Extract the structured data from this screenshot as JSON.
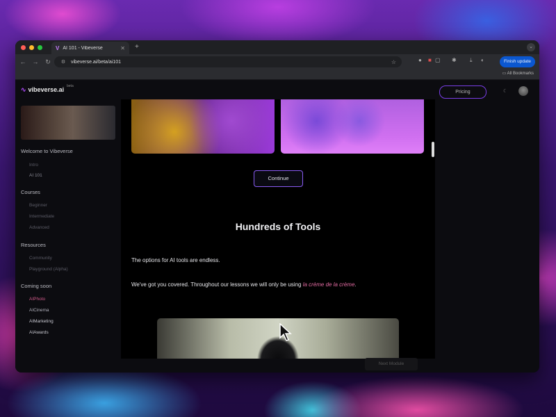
{
  "browser": {
    "tab_title": "AI 101 - Vibeverse",
    "tab_favicon": "V",
    "url": "vibeverse.ai/beta/ai101",
    "finish_update": "Finish update",
    "all_bookmarks": "All Bookmarks"
  },
  "site": {
    "logo": "vibeverse.ai",
    "beta": "beta",
    "pricing": "Pricing"
  },
  "sidebar": {
    "sections": [
      {
        "title": "Welcome to Vibeverse",
        "items": [
          "Intro",
          "AI 101"
        ]
      },
      {
        "title": "Courses",
        "items": [
          "Beginner",
          "Intermediate",
          "Advanced"
        ]
      },
      {
        "title": "Resources",
        "items": [
          "Community",
          "Playground (Alpha)"
        ]
      },
      {
        "title": "Coming soon",
        "items": [
          "AIPhoto",
          "AICinema",
          "AIMarketing",
          "AIAwards"
        ]
      }
    ]
  },
  "main": {
    "continue": "Continue",
    "heading": "Hundreds of Tools",
    "p1": "The options for AI tools are endless.",
    "p2_before": "We've got you covered. Throughout our lessons we will only be using ",
    "p2_emphasis": "la crème de la crème",
    "p2_after": ".",
    "next_module": "Next Module"
  },
  "colors": {
    "accent": "#8a5cf5",
    "emphasis": "#e06aa0"
  }
}
